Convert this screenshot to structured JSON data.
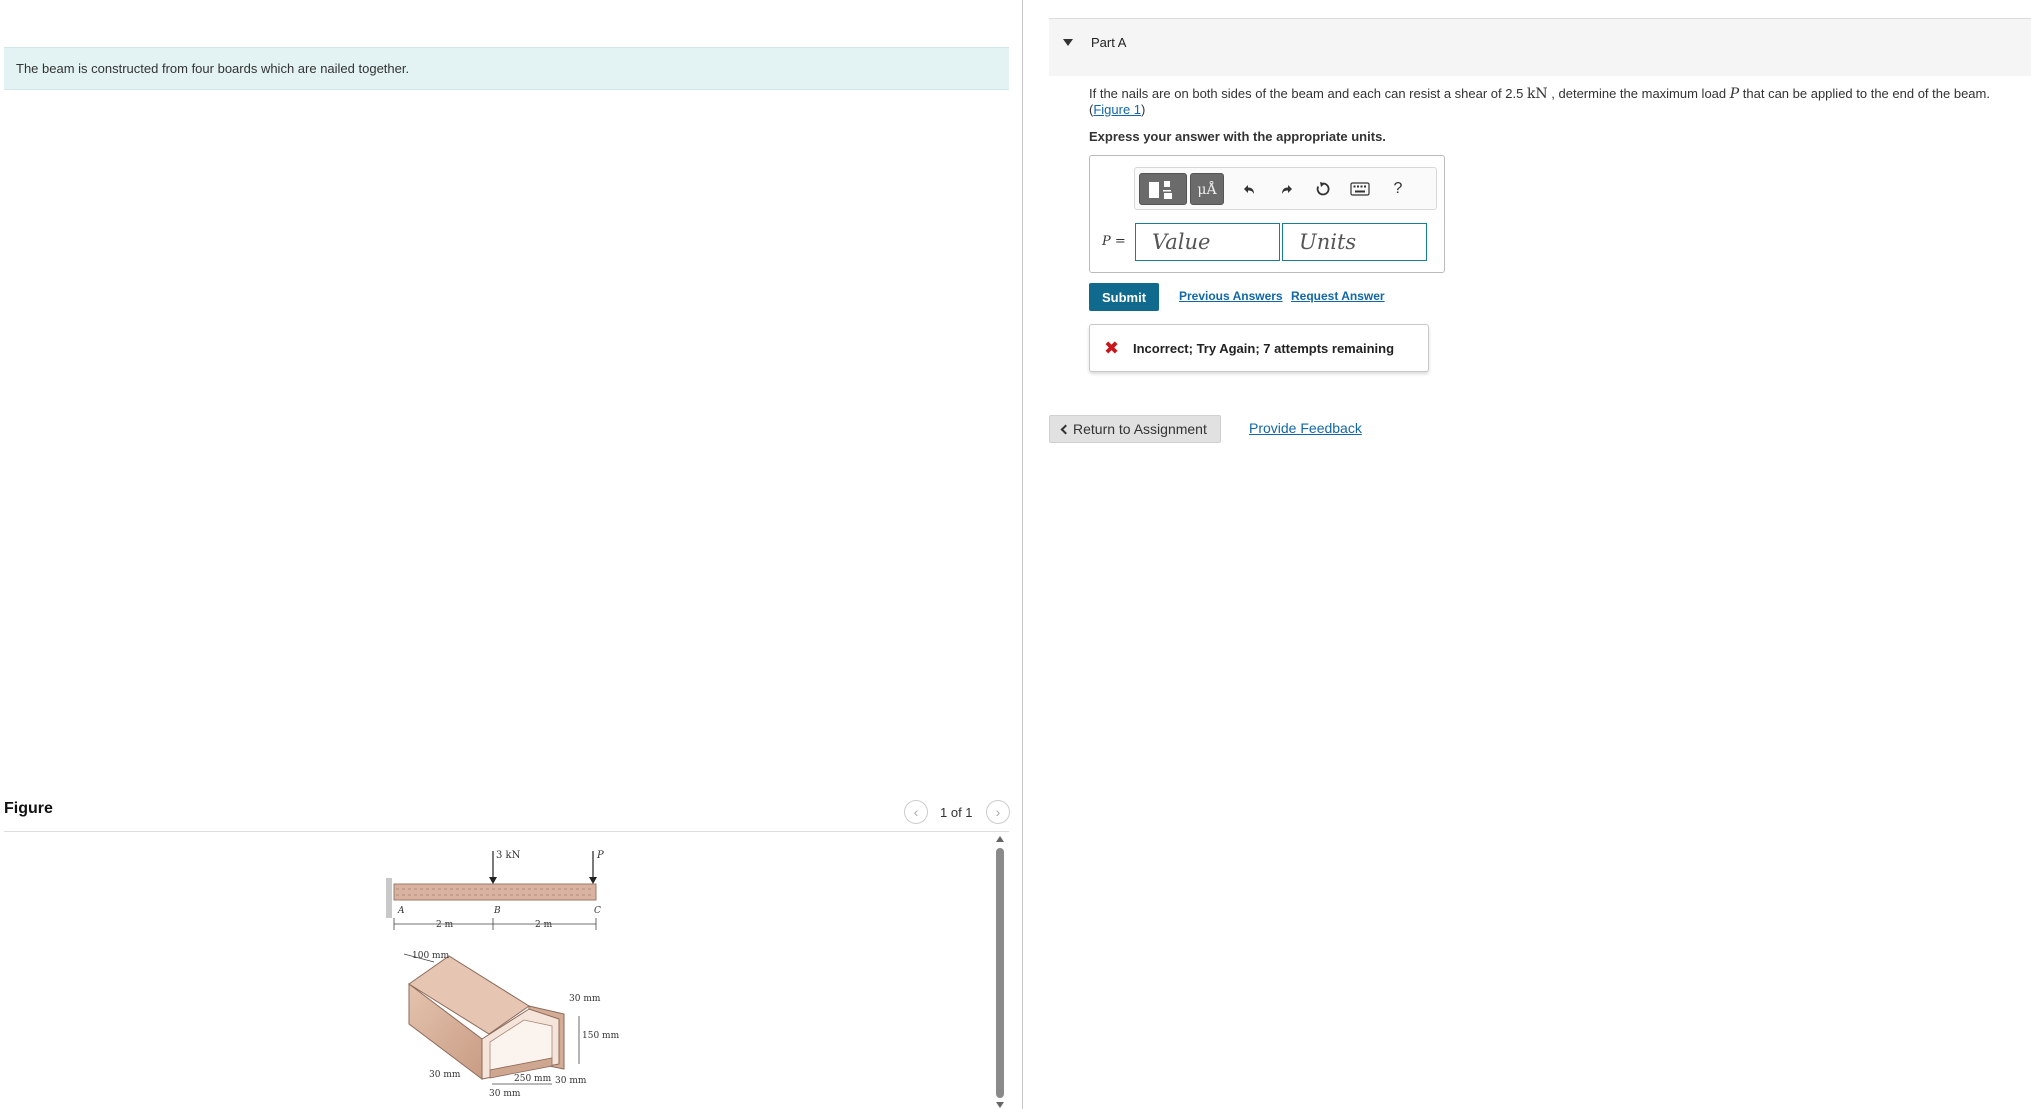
{
  "intro": {
    "text": "The beam is constructed from four boards which are nailed together."
  },
  "figure": {
    "title": "Figure",
    "counter": "1 of 1",
    "prev_icon": "chevron-left-icon",
    "next_icon": "chevron-right-icon",
    "labels": {
      "load_b": "3 kN",
      "load_c": "P",
      "point_a": "A",
      "point_b": "B",
      "point_c": "C",
      "span_ab": "2 m",
      "span_bc": "2 m",
      "dim_100": "100 mm",
      "dim_30_top": "30 mm",
      "dim_150": "150 mm",
      "dim_30_left": "30 mm",
      "dim_250": "250 mm",
      "dim_30_bottom": "30 mm",
      "dim_30_bottom2": "30 mm"
    }
  },
  "part": {
    "title": "Part A",
    "question_pre": "If the nails are on both sides of the beam and each can resist a shear of 2.5 ",
    "question_unit": "kN",
    "question_mid": " , determine the maximum load ",
    "question_var": "P",
    "question_post": " that can be applied to the end of the beam.",
    "figure_link_open": "(",
    "figure_link": "Figure 1",
    "figure_link_close": ")",
    "instruction": "Express your answer with the appropriate units."
  },
  "answer": {
    "toolbar": {
      "templates_icon": "templates-icon",
      "units_label": "μÅ",
      "undo_icon": "undo-icon",
      "redo_icon": "redo-icon",
      "reset_icon": "reset-icon",
      "keyboard_icon": "keyboard-icon",
      "help_label": "?"
    },
    "variable_label": "P =",
    "value_placeholder": "Value",
    "units_placeholder": "Units"
  },
  "actions": {
    "submit_label": "Submit",
    "previous_answers": "Previous Answers",
    "request_answer": "Request Answer"
  },
  "feedback": {
    "icon": "x-mark-icon",
    "text": "Incorrect; Try Again; 7 attempts remaining"
  },
  "footer": {
    "return_label": "Return to Assignment",
    "provide_feedback": "Provide Feedback"
  },
  "colors": {
    "accent": "#0f6a8e",
    "link": "#1167a8",
    "error": "#c7161c",
    "intro_bg": "#e3f2f2"
  }
}
